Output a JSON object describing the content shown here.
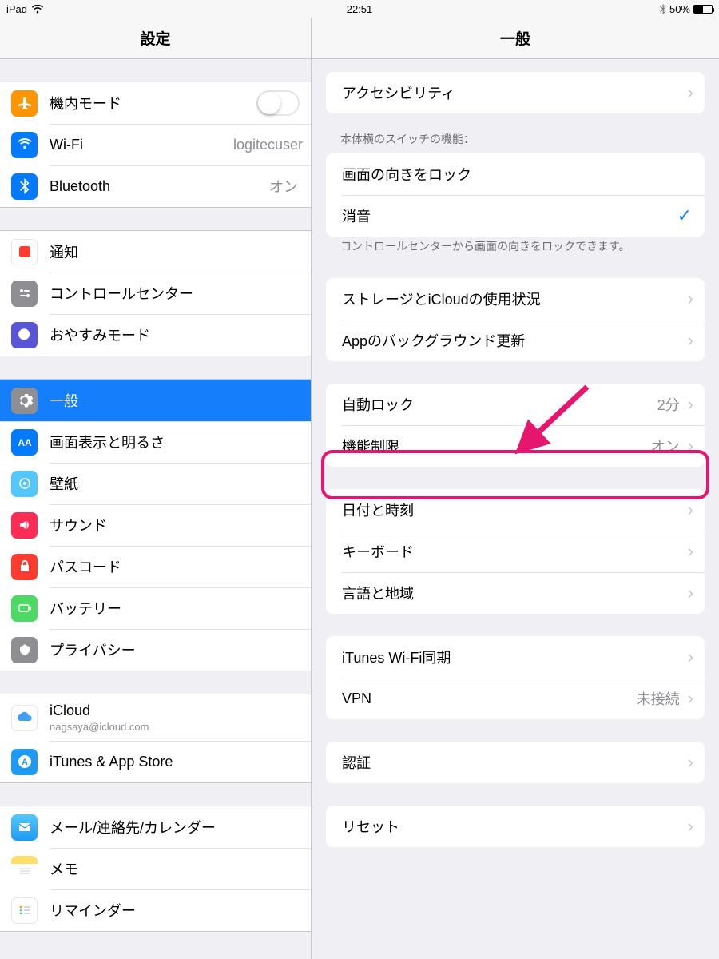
{
  "statusbar": {
    "device": "iPad",
    "time": "22:51",
    "battery_pct": "50%"
  },
  "header": {
    "left_title": "設定",
    "right_title": "一般"
  },
  "sidebar": {
    "g1": {
      "airplane": "機内モード",
      "wifi": "Wi-Fi",
      "wifi_value": "logitecuser",
      "bluetooth": "Bluetooth",
      "bluetooth_value": "オン"
    },
    "g2": {
      "notifications": "通知",
      "control_center": "コントロールセンター",
      "dnd": "おやすみモード"
    },
    "g3": {
      "general": "一般",
      "display": "画面表示と明るさ",
      "wallpaper": "壁紙",
      "sounds": "サウンド",
      "passcode": "パスコード",
      "battery": "バッテリー",
      "privacy": "プライバシー"
    },
    "g4": {
      "icloud": "iCloud",
      "icloud_sub": "nagsaya@icloud.com",
      "itunes": "iTunes & App Store"
    },
    "g5": {
      "mail": "メール/連絡先/カレンダー",
      "notes": "メモ",
      "reminders": "リマインダー"
    }
  },
  "detail": {
    "accessibility": "アクセシビリティ",
    "switch_caption": "本体横のスイッチの機能：",
    "lock_rotation": "画面の向きをロック",
    "mute": "消音",
    "switch_footer": "コントロールセンターから画面の向きをロックできます。",
    "storage": "ストレージとiCloudの使用状況",
    "bg_refresh": "Appのバックグラウンド更新",
    "autolock": "自動ロック",
    "autolock_value": "2分",
    "restrictions": "機能制限",
    "restrictions_value": "オン",
    "datetime": "日付と時刻",
    "keyboard": "キーボード",
    "language": "言語と地域",
    "itunes_wifi": "iTunes Wi-Fi同期",
    "vpn": "VPN",
    "vpn_value": "未接続",
    "cert": "認証",
    "reset": "リセット"
  }
}
